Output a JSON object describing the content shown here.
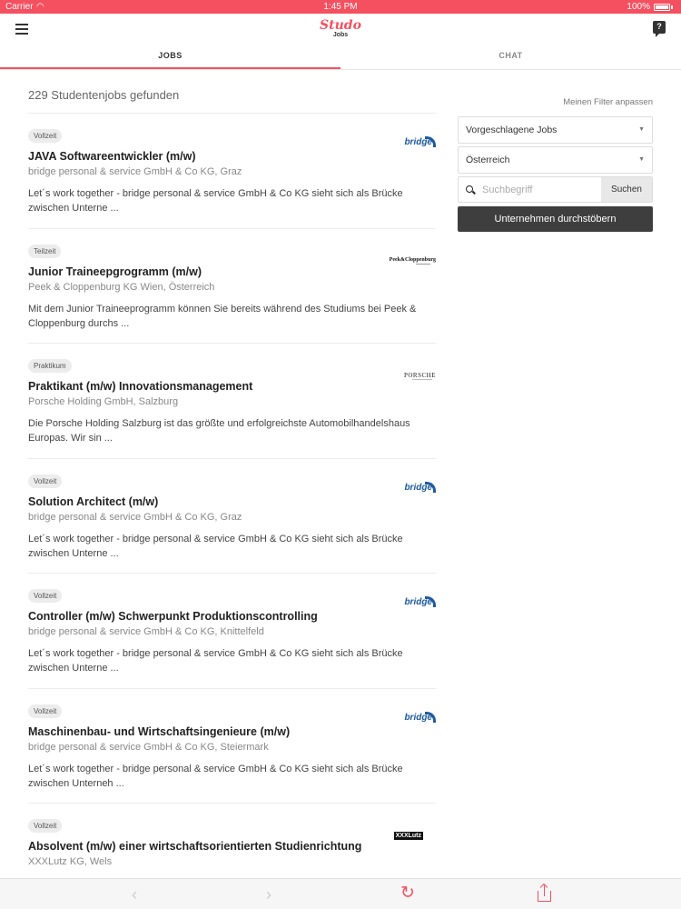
{
  "status_bar": {
    "carrier": "Carrier",
    "time": "1:45 PM",
    "battery": "100%"
  },
  "nav": {
    "brand": "Studo",
    "subtitle": "Jobs",
    "help": "?"
  },
  "tabs": [
    {
      "label": "JOBS",
      "active": true
    },
    {
      "label": "CHAT",
      "active": false
    }
  ],
  "results": {
    "count_text": "229 Studentenjobs gefunden"
  },
  "filters": {
    "adjust_link": "Meinen Filter anpassen",
    "category_select": "Vorgeschlagene Jobs",
    "country_select": "Österreich",
    "search_placeholder": "Suchbegriff",
    "search_button": "Suchen",
    "browse_button": "Unternehmen durchstöbern"
  },
  "jobs": [
    {
      "badge": "Vollzeit",
      "title": "JAVA Softwareentwickler (m/w)",
      "company": "bridge personal & service GmbH & Co KG, Graz",
      "description": "Let´s work together - bridge personal & service GmbH & Co KG sieht sich als Brücke zwischen Unterne ...",
      "logo": "bridge"
    },
    {
      "badge": "Teilzeit",
      "title": "Junior Traineepgrogramm (m/w)",
      "company": "Peek & Cloppenburg KG Wien, Österreich",
      "description": "Mit dem Junior Traineeprogramm können Sie bereits während des Studiums bei Peek & Cloppenburg durchs ...",
      "logo": "Peek&Cloppenburg"
    },
    {
      "badge": "Praktikum",
      "title": "Praktikant (m/w) Innovationsmanagement",
      "company": "Porsche Holding GmbH, Salzburg",
      "description": "Die Porsche Holding Salzburg ist das größte und erfolgreichste Automobilhandelshaus Europas. Wir sin ...",
      "logo": "PORSCHE"
    },
    {
      "badge": "Vollzeit",
      "title": "Solution Architect (m/w)",
      "company": "bridge personal & service GmbH & Co KG, Graz",
      "description": "Let´s work together - bridge personal & service GmbH & Co KG sieht sich als Brücke zwischen Unterne ...",
      "logo": "bridge"
    },
    {
      "badge": "Vollzeit",
      "title": "Controller (m/w) Schwerpunkt Produktionscontrolling",
      "company": "bridge personal & service GmbH & Co KG, Knittelfeld",
      "description": "Let´s work together - bridge personal & service GmbH & Co KG sieht sich als Brücke zwischen Unterne ...",
      "logo": "bridge"
    },
    {
      "badge": "Vollzeit",
      "title": "Maschinenbau- und Wirtschaftsingenieure (m/w)",
      "company": "bridge personal & service GmbH & Co KG, Steiermark",
      "description": "Let´s work together - bridge personal & service GmbH & Co KG sieht sich als Brücke zwischen Unterneh ...",
      "logo": "bridge"
    },
    {
      "badge": "Vollzeit",
      "title": "Absolvent (m/w) einer wirtschaftsorientierten Studienrichtung",
      "company": "XXXLutz KG, Wels",
      "description": "",
      "logo": "XXXLutz"
    }
  ],
  "colors": {
    "accent": "#f4505f",
    "dark_button": "#3e3e3e",
    "bridge_blue": "#1d5aa0"
  },
  "icons": {
    "menu": "hamburger-icon",
    "help": "help-bubble-icon",
    "search": "magnifier-icon",
    "back": "chevron-left-icon",
    "forward": "chevron-right-icon",
    "reload": "reload-icon",
    "share": "share-icon"
  }
}
